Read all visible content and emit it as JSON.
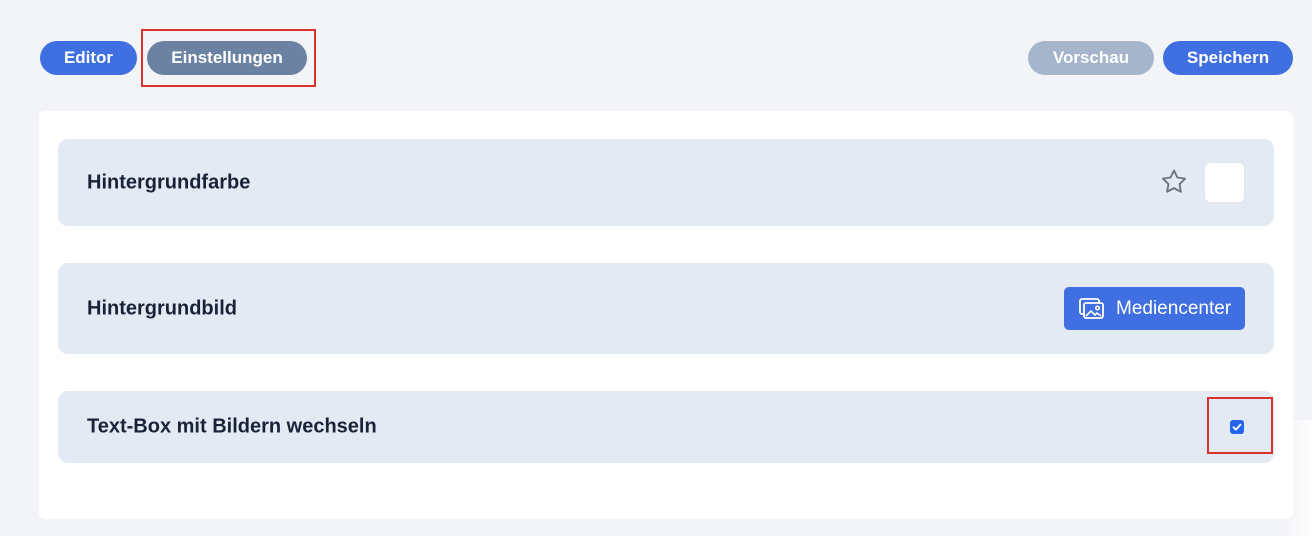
{
  "toolbar": {
    "editor_label": "Editor",
    "settings_label": "Einstellungen",
    "preview_label": "Vorschau",
    "save_label": "Speichern"
  },
  "settings": {
    "background_color": {
      "label": "Hintergrundfarbe",
      "icon": "star-icon",
      "value": "#ffffff"
    },
    "background_image": {
      "label": "Hintergrundbild",
      "button_label": "Mediencenter",
      "icon": "image-gallery-icon"
    },
    "textbox_alternate": {
      "label": "Text-Box mit Bildern wechseln",
      "checked": true
    }
  },
  "colors": {
    "accent": "#3f6fe0",
    "active_tab": "#6b82a3",
    "disabled": "#a5b6cc",
    "row_background": "#e3eaf4",
    "highlight": "#d9342b"
  }
}
